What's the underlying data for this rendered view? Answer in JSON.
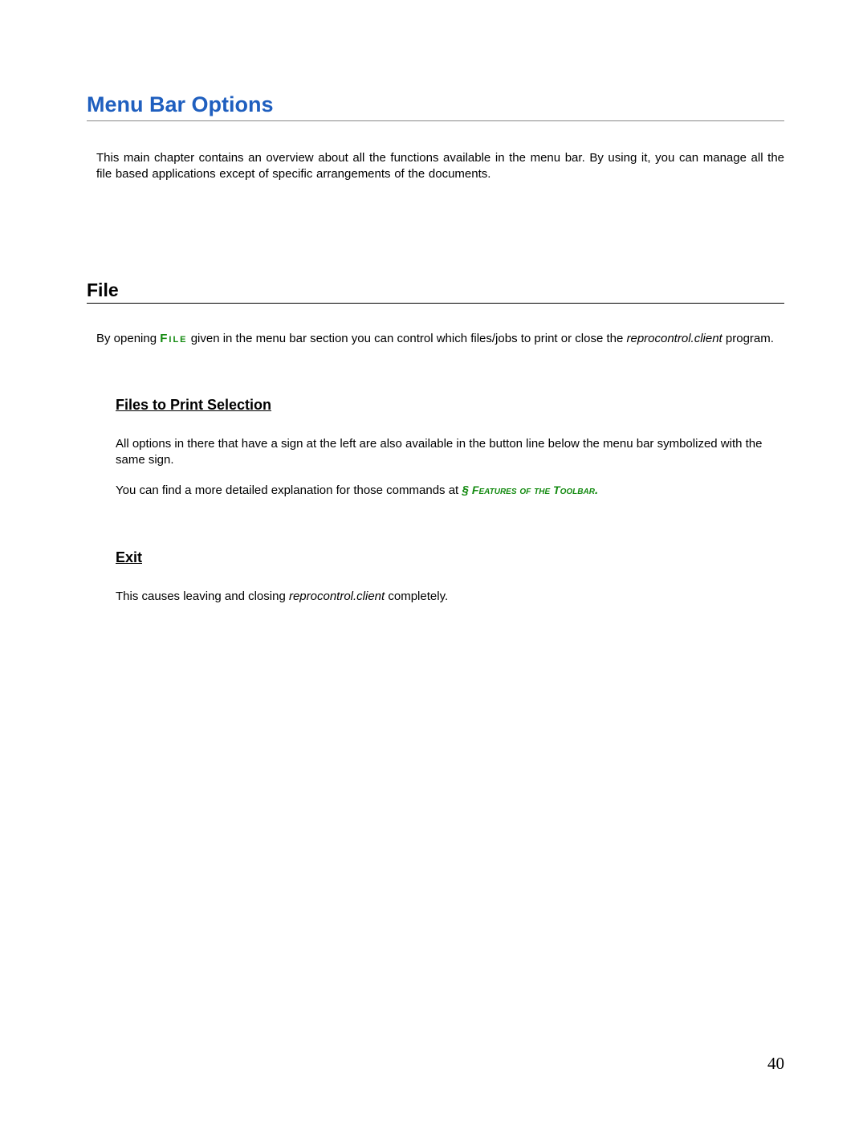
{
  "chapter": {
    "title": "Menu Bar Options",
    "intro": "This main chapter contains an overview about all the functions available in the menu bar. By using it, you can manage all the file based applications except of specific arrangements of the documents."
  },
  "section_file": {
    "heading": "File",
    "p1_a": "By opening ",
    "p1_cmd": "File",
    "p1_b": " given in the menu bar section you can control which files/jobs to print or close the ",
    "p1_prog": "reprocontrol.client",
    "p1_c": " program."
  },
  "sub_files_to_print": {
    "heading": "Files to Print Selection",
    "p1": "All options in there that have a sign at the left are also available in the button line below the menu bar symbolized with the same sign.",
    "p2_a": "You can find a more detailed explanation for those commands at ",
    "p2_sym": "§ ",
    "p2_ref": "Features of the Toolbar",
    "p2_dot": "."
  },
  "sub_exit": {
    "heading": "Exit",
    "p1_a": "This causes leaving and closing ",
    "p1_prog": "reprocontrol.client",
    "p1_b": " completely."
  },
  "page_number": "40"
}
